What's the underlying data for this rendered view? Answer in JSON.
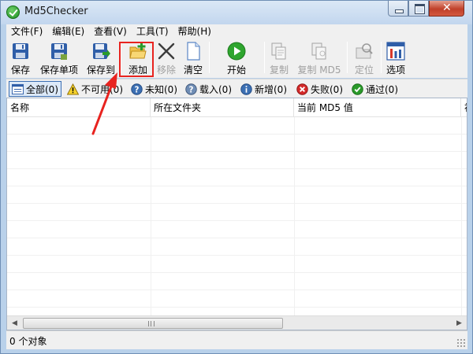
{
  "window": {
    "title": "Md5Checker"
  },
  "menu": [
    "文件(F)",
    "编辑(E)",
    "查看(V)",
    "工具(T)",
    "帮助(H)"
  ],
  "toolbar": {
    "save": "保存",
    "save_single": "保存单项",
    "save_to": "保存到",
    "add": "添加",
    "remove": "移除",
    "clear": "清空",
    "start": "开始",
    "copy": "复制",
    "copy_md5": "复制 MD5",
    "locate": "定位",
    "options": "选项"
  },
  "filters": {
    "all": "全部(0)",
    "unavailable": "不可用(0)",
    "unknown": "未知(0)",
    "loaded": "载入(0)",
    "new": "新增(0)",
    "failed": "失败(0)",
    "passed": "通过(0)"
  },
  "columns": [
    "名称",
    "所在文件夹",
    "当前 MD5 值",
    "初"
  ],
  "status": {
    "text": "0 个对象"
  },
  "colors": {
    "highlight": "#e8231f",
    "accent": "#3b6fb3",
    "success": "#2a9a2a",
    "error": "#d42a2a"
  }
}
